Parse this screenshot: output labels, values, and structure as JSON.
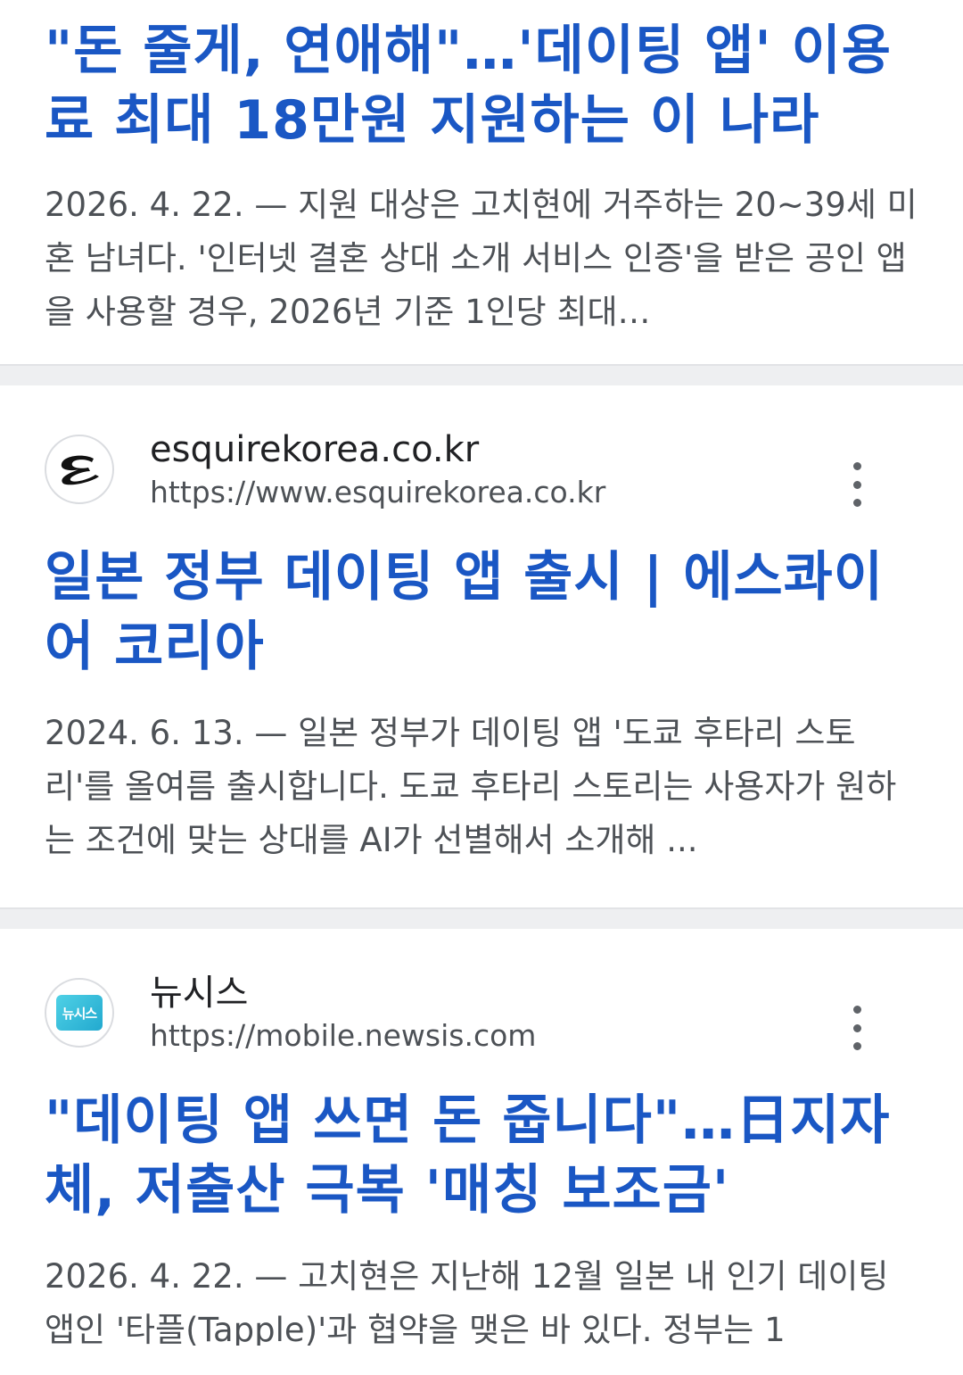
{
  "results": [
    {
      "title": "\"돈 줄게, 연애해\"…'데이팅 앱' 이용료 최대 18만원 지원하는 이 나라",
      "date": "2026. 4. 22.",
      "snippet": "2026. 4. 22. — 지원 대상은 고치현에 거주하는 20~39세 미혼 남녀다. '인터넷 결혼 상대 소개 서비스 인증'을 받은 공인 앱을 사용할 경우, 2026년 기준 1인당 최대…"
    },
    {
      "site_name": "esquirekorea.co.kr",
      "site_url": "https://www.esquirekorea.co.kr",
      "favicon_icon": "esquire-e-logo-icon",
      "title": "일본 정부 데이팅 앱 출시 | 에스콰이어 코리아",
      "snippet": "2024. 6. 13. — 일본 정부가 데이팅 앱 '도쿄 후타리 스토리'를 올여름 출시합니다. 도쿄 후타리 스토리는 사용자가 원하는 조건에 맞는 상대를 AI가 선별해서 소개해 ..."
    },
    {
      "site_name": "뉴시스",
      "site_url": "https://mobile.newsis.com",
      "favicon_icon": "newsis-logo-icon",
      "favicon_text": "뉴시스",
      "title": "\"데이팅 앱 쓰면 돈 줍니다\"…日지자체, 저출산 극복 '매칭 보조금'",
      "snippet": "2026. 4. 22. — 고치현은 지난해 12월 일본 내 인기 데이팅 앱인 '타플(Tapple)'과 협약을 맺은 바 있다. 정부는 1"
    }
  ],
  "colors": {
    "title_link": "#1a57c4",
    "snippet": "#4d5156",
    "divider": "#eeeff1"
  }
}
